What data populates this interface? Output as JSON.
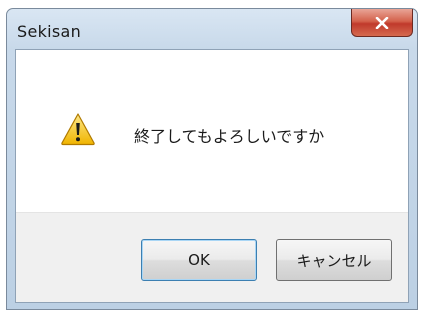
{
  "window": {
    "title": "Sekisan"
  },
  "dialog": {
    "icon": "warning-icon",
    "message": "終了してもよろしいですか"
  },
  "buttons": {
    "ok_label": "OK",
    "cancel_label": "キャンセル"
  },
  "colors": {
    "close_button": "#c0392b",
    "warning_yellow": "#f4c20d",
    "titlebar": "#c8d9ea",
    "button_face": "#e5e5e5"
  }
}
